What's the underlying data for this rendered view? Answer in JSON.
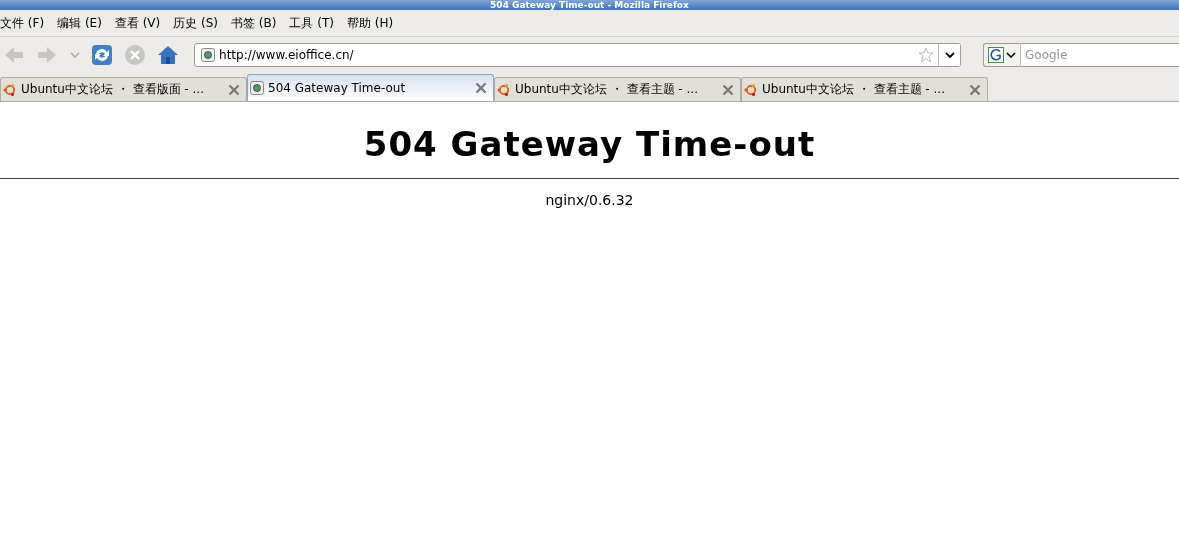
{
  "window": {
    "title": "504 Gateway Time-out - Mozilla Firefox"
  },
  "menu": [
    "文件 (F)",
    "编辑 (E)",
    "查看 (V)",
    "历史 (S)",
    "书签 (B)",
    "工具 (T)",
    "帮助 (H)"
  ],
  "navigation": {
    "back_disabled": true,
    "forward_disabled": true,
    "stop_disabled": true,
    "url": "http://www.eioffice.cn/",
    "search": {
      "placeholder": "Google"
    }
  },
  "tabs": [
    {
      "label": "Ubuntu中文论坛 ・ 查看版面 - ...",
      "kind": "ubuntu",
      "selected": false
    },
    {
      "label": "504 Gateway Time-out",
      "kind": "page",
      "selected": true
    },
    {
      "label": "Ubuntu中文论坛 ・ 查看主题 - ...",
      "kind": "ubuntu",
      "selected": false
    },
    {
      "label": "Ubuntu中文论坛 ・ 查看主题 - ...",
      "kind": "ubuntu",
      "selected": false
    }
  ],
  "page": {
    "heading": "504 Gateway Time-out",
    "footer": "nginx/0.6.32"
  }
}
